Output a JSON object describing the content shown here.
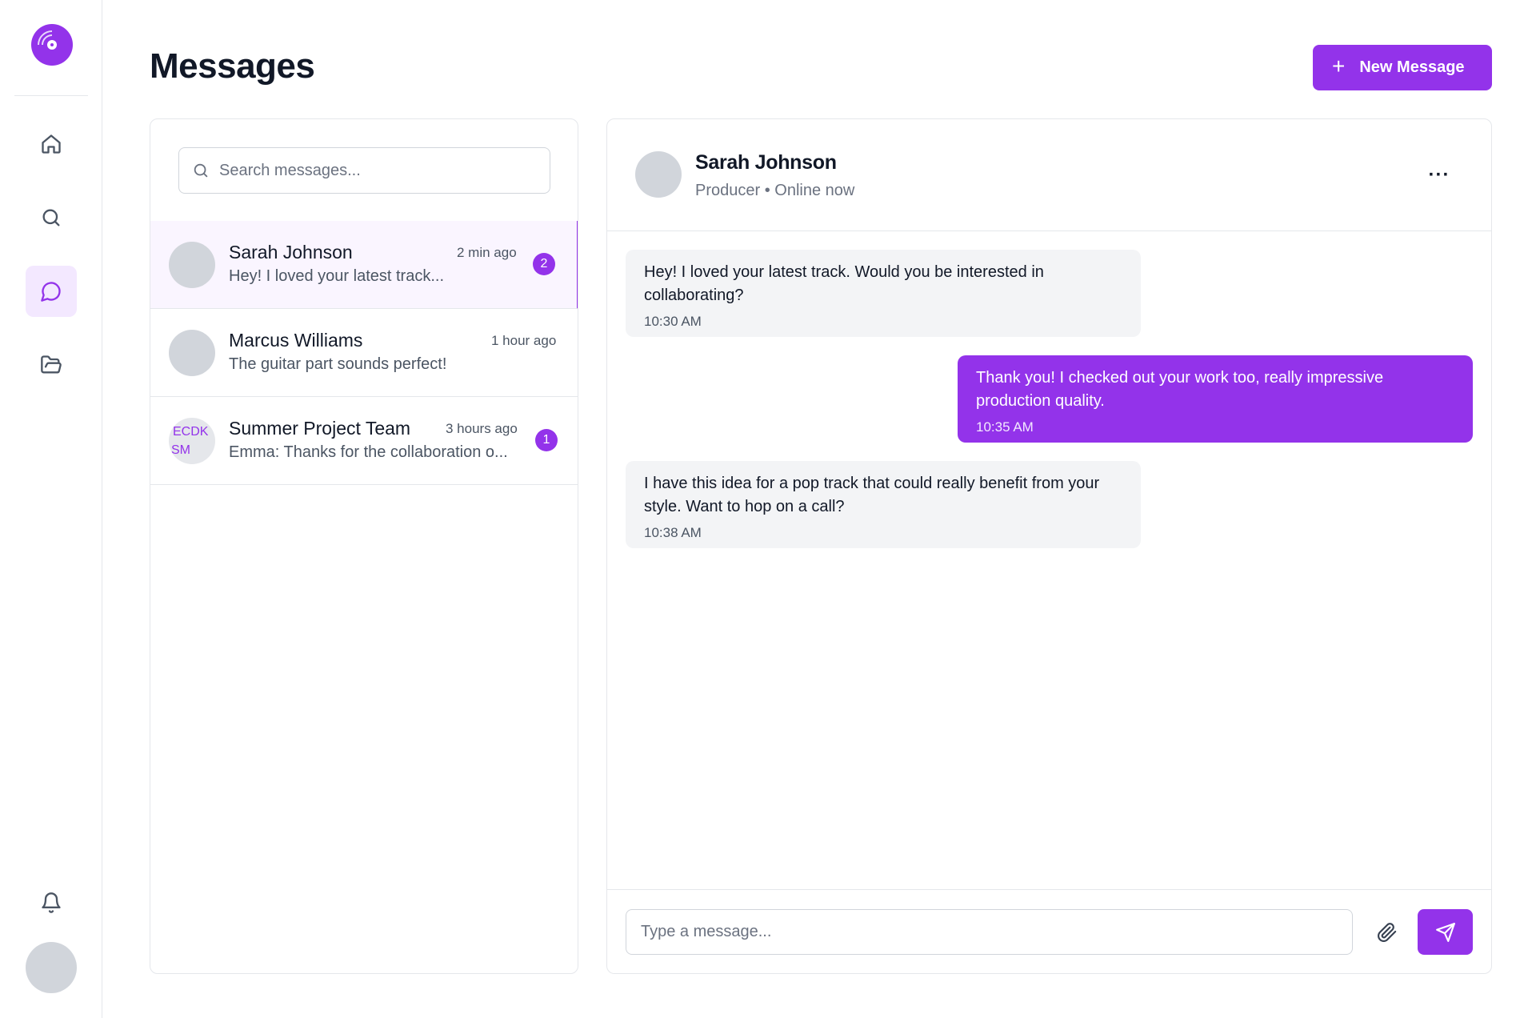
{
  "app": {
    "accent_color": "#9333ea"
  },
  "sidebar": {
    "logo_icon": "vinyl-record-icon",
    "nav": [
      {
        "icon": "home-icon",
        "active": false
      },
      {
        "icon": "search-icon",
        "active": false
      },
      {
        "icon": "message-bubble-icon",
        "active": true
      },
      {
        "icon": "folder-open-icon",
        "active": false
      }
    ],
    "bottom": {
      "icon": "bell-icon"
    }
  },
  "header": {
    "title": "Messages",
    "new_message_icon": "plus-icon",
    "new_message_label": "New Message"
  },
  "conversations": {
    "search_placeholder": "Search messages...",
    "items": [
      {
        "name": "Sarah Johnson",
        "time": "2 min ago",
        "preview": "Hey! I loved your latest track...",
        "unread": "2",
        "selected": true
      },
      {
        "name": "Marcus Williams",
        "time": "1 hour ago",
        "preview": "The guitar part sounds perfect!",
        "unread": null,
        "selected": false
      },
      {
        "name": "Summer Project Team",
        "time": "3 hours ago",
        "preview": "Emma: Thanks for the collaboration o...",
        "unread": "1",
        "selected": false,
        "avatar_initials": [
          "ECDK",
          "SM"
        ]
      }
    ]
  },
  "chat": {
    "contact_name": "Sarah Johnson",
    "contact_role": "Producer",
    "contact_status": "Online now",
    "more_label": "···",
    "messages": [
      {
        "direction": "in",
        "text": "Hey! I loved your latest track. Would you be interested in collaborating?",
        "time": "10:30 AM"
      },
      {
        "direction": "out",
        "text": "Thank you! I checked out your work too, really impressive production quality.",
        "time": "10:35 AM"
      },
      {
        "direction": "in",
        "text": "I have this idea for a pop track that could really benefit from your style. Want to hop on a call?",
        "time": "10:38 AM"
      }
    ],
    "composer": {
      "placeholder": "Type a message...",
      "attach_icon": "paperclip-icon",
      "send_icon": "send-icon"
    }
  }
}
